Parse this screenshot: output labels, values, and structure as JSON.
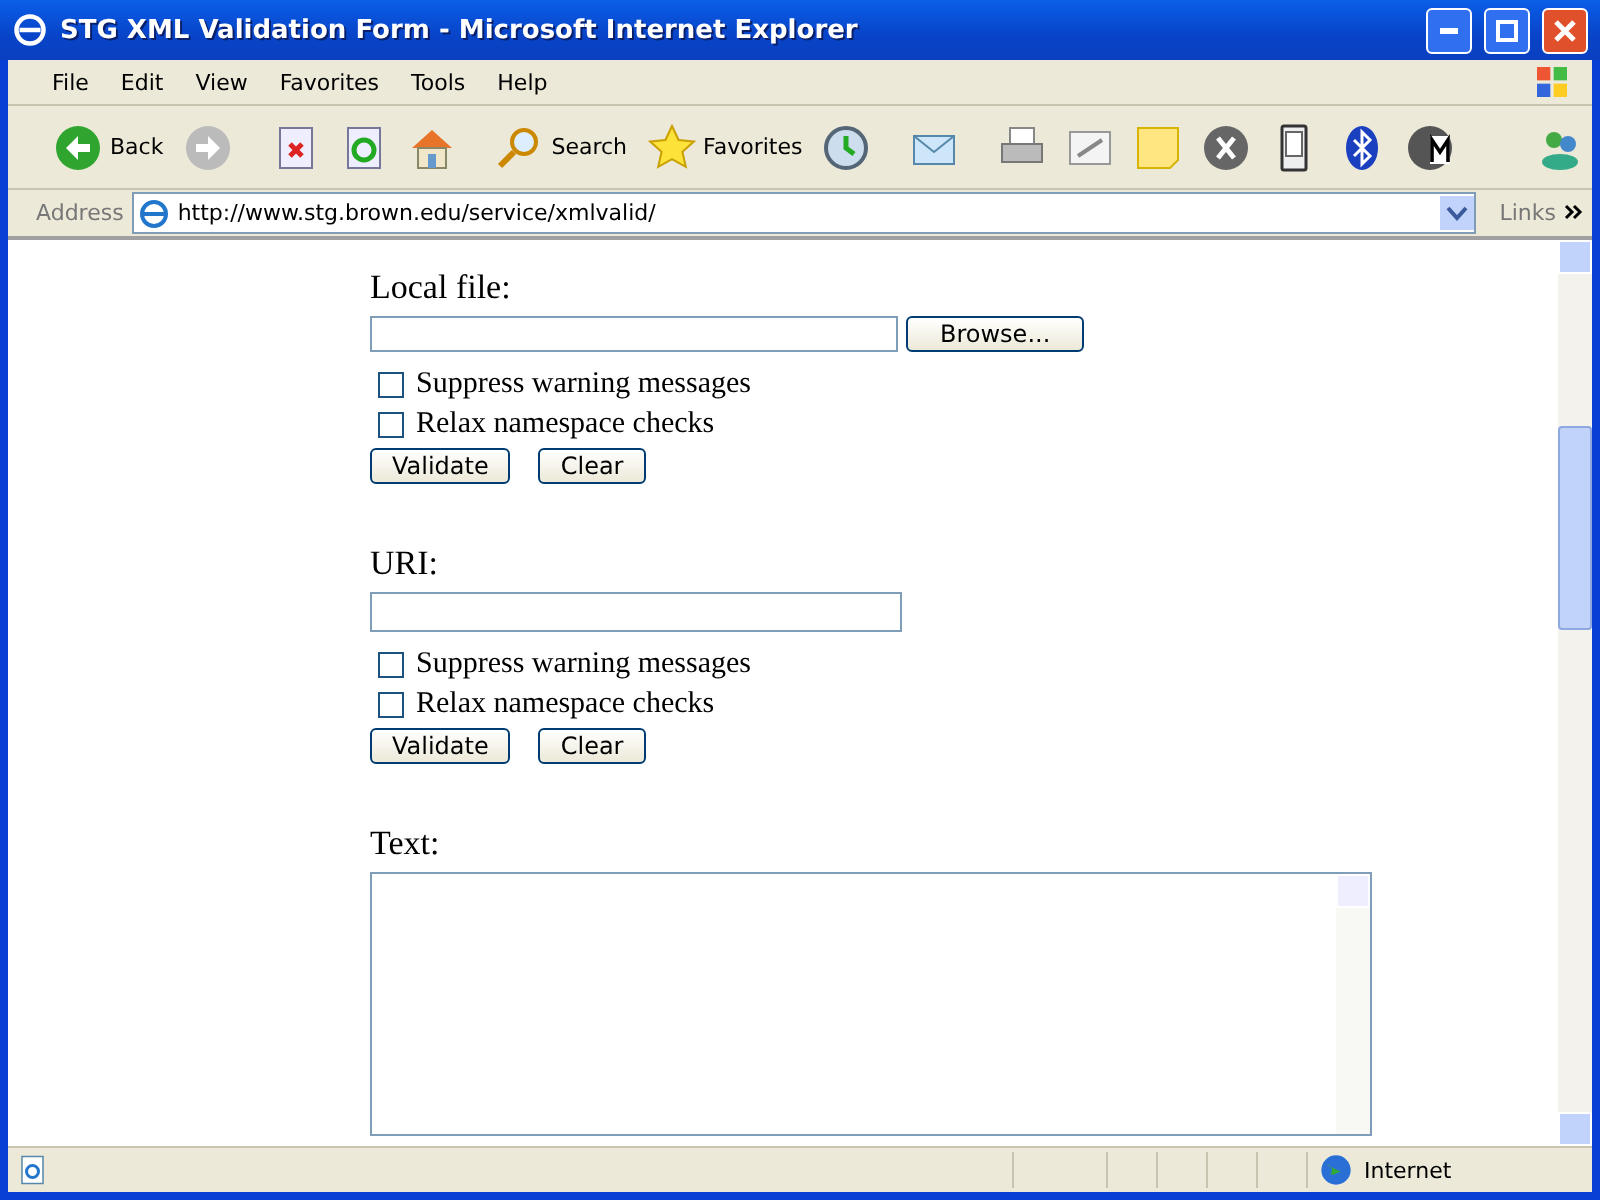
{
  "window": {
    "title": "STG XML Validation Form - Microsoft Internet Explorer"
  },
  "menu": [
    "File",
    "Edit",
    "View",
    "Favorites",
    "Tools",
    "Help"
  ],
  "toolbar": [
    {
      "kind": "back",
      "label": "Back"
    },
    {
      "kind": "forward"
    },
    {
      "kind": "stop"
    },
    {
      "kind": "refresh"
    },
    {
      "kind": "home"
    },
    {
      "kind": "search",
      "label": "Search"
    },
    {
      "kind": "favorites",
      "label": "Favorites"
    },
    {
      "kind": "history"
    },
    {
      "kind": "mail"
    },
    {
      "kind": "print"
    },
    {
      "kind": "edit"
    },
    {
      "kind": "note"
    },
    {
      "kind": "xcircle"
    },
    {
      "kind": "device"
    },
    {
      "kind": "bluetooth"
    },
    {
      "kind": "mlogo"
    }
  ],
  "address": {
    "label": "Address",
    "url": "http://www.stg.brown.edu/service/xmlvalid/",
    "links": "Links"
  },
  "sections": [
    {
      "kind": "file",
      "heading": "Local file:",
      "browse": "Browse...",
      "options": [
        {
          "label": "Suppress warning messages",
          "checked": false
        },
        {
          "label": "Relax namespace checks",
          "checked": false
        }
      ],
      "buttons": [
        "Validate",
        "Clear"
      ]
    },
    {
      "kind": "uri",
      "heading": "URI:",
      "options": [
        {
          "label": "Suppress warning messages",
          "checked": false
        },
        {
          "label": "Relax namespace checks",
          "checked": false
        }
      ],
      "buttons": [
        "Validate",
        "Clear"
      ]
    },
    {
      "kind": "text",
      "heading": "Text:"
    }
  ],
  "status_bar": {
    "zone": "Internet"
  }
}
